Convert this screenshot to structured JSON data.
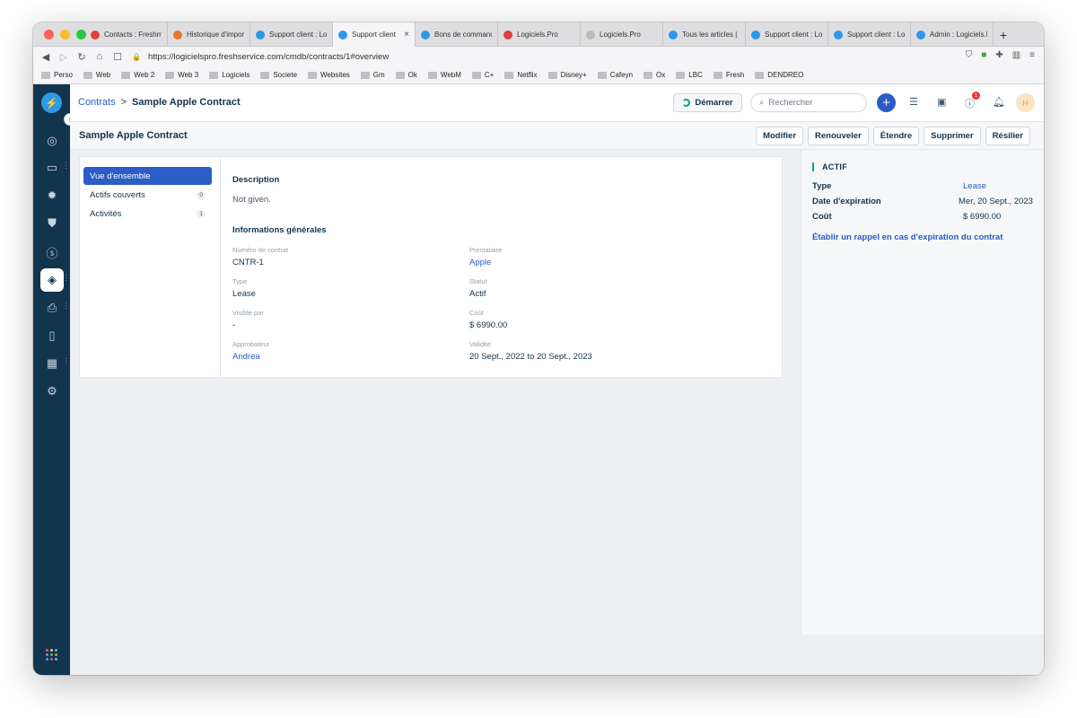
{
  "browser": {
    "tabs": [
      {
        "label": "Contacts : Freshm",
        "color": "#e2403b"
      },
      {
        "label": "Historique d'impor",
        "color": "#e6792b"
      },
      {
        "label": "Support client : Lo",
        "color": "#2c9ae6"
      },
      {
        "label": "Support client",
        "color": "#2c9ae6",
        "active": true
      },
      {
        "label": "Bons de command",
        "color": "#2c9ae6"
      },
      {
        "label": "Logiciels.Pro",
        "color": "#e2403b"
      },
      {
        "label": "Logiciels.Pro",
        "color": "#bbbbbb"
      },
      {
        "label": "Tous les articles | ",
        "color": "#2c9ae6"
      },
      {
        "label": "Support client : Lo",
        "color": "#2c9ae6"
      },
      {
        "label": "Support client : Lo",
        "color": "#2c9ae6"
      },
      {
        "label": "Admin : Logiciels.P",
        "color": "#2c9ae6"
      }
    ],
    "url": "https://logicielspro.freshservice.com/cmdb/contracts/1#overview",
    "bookmarks": [
      "Perso",
      "Web",
      "Web 2",
      "Web 3",
      "Logiciels",
      "Societe",
      "Websites",
      "Gm",
      "Ok",
      "WebM",
      "C+",
      "Netflix",
      "Disney+",
      "Cafeyn",
      "Ox",
      "LBC",
      "Fresh",
      "DENDREO"
    ]
  },
  "topbar": {
    "breadcrumb_root": "Contrats",
    "breadcrumb_sep": ">",
    "breadcrumb_current": "Sample Apple Contract",
    "start_label": "Démarrer",
    "search_placeholder": "Rechercher",
    "notifications_badge": "1",
    "avatar_initial": "H"
  },
  "header": {
    "title": "Sample Apple Contract",
    "actions": [
      "Modifier",
      "Renouveler",
      "Étendre",
      "Supprimer",
      "Résilier"
    ]
  },
  "subnav": [
    {
      "label": "Vue d'ensemble",
      "count": "",
      "active": true
    },
    {
      "label": "Actifs couverts",
      "count": "0"
    },
    {
      "label": "Activités",
      "count": "1"
    }
  ],
  "details": {
    "description_title": "Description",
    "description_text": "Not given.",
    "general_title": "Informations générales",
    "fields": [
      {
        "label": "Numéro de contrat",
        "value": "CNTR-1",
        "link": false
      },
      {
        "label": "Prestataire",
        "value": "Apple",
        "link": true
      },
      {
        "label": "Type",
        "value": "Lease",
        "link": false
      },
      {
        "label": "Statut",
        "value": "Actif",
        "link": false
      },
      {
        "label": "Visible par",
        "value": "-",
        "link": false
      },
      {
        "label": "Coût",
        "value": "$ 6990.00",
        "link": false
      },
      {
        "label": "Approbateur",
        "value": "Andrea",
        "link": true
      },
      {
        "label": "Validité",
        "value": "20 Sept., 2022 to 20 Sept., 2023",
        "link": false
      }
    ]
  },
  "summary": {
    "status": "ACTIF",
    "rows": [
      {
        "key": "Type",
        "value": "Lease",
        "link": true
      },
      {
        "key": "Date d'expiration",
        "value": "Mer, 20 Sept., 2023",
        "link": false
      },
      {
        "key": "Coût",
        "value": "$ 6990.00",
        "link": false
      }
    ],
    "reminder_link": "Établir un rappel en cas d'expiration du contrat"
  },
  "colors": {
    "sidebar": "#12344d",
    "primary": "#2c5cc5",
    "accent": "#00a886"
  }
}
